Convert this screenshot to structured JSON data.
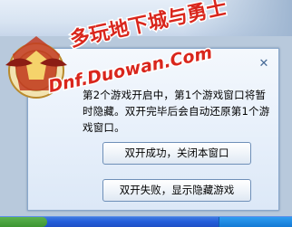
{
  "dialog": {
    "message": "第2个游戏开启中，第1个游戏窗口将暂时隐藏。双开完毕后会自动还原第1个游戏窗口。",
    "close_label": "✕",
    "ok_button": "双开成功，关闭本窗口",
    "fail_button": "双开失败，显示隐藏游戏"
  },
  "watermark": {
    "title": "多玩地下城与勇士",
    "url": "Dnf.Duowan.Com"
  },
  "colors": {
    "watermark_red": "#d9261c",
    "dialog_border": "#8aa8cc",
    "taskbar_blue": "#245edb"
  }
}
